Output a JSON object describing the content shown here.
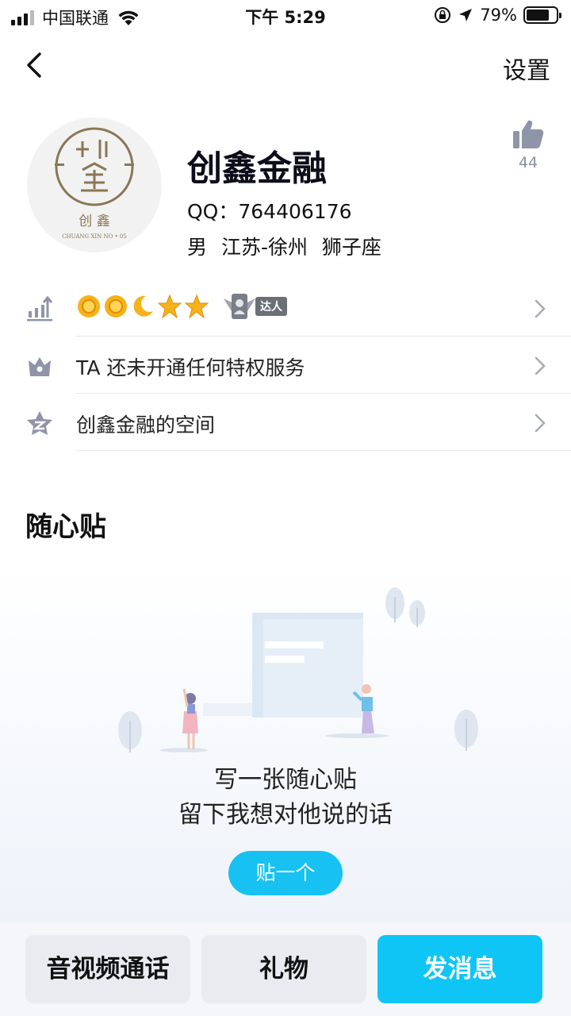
{
  "status_bar": {
    "carrier": "中国联通",
    "time": "下午 5:29",
    "battery": "79%",
    "battery_level": 0.79
  },
  "nav": {
    "settings_label": "设置"
  },
  "profile": {
    "name": "创鑫金融",
    "qq": "QQ：764406176",
    "info": "男 江苏-徐州 狮子座",
    "likes": "44",
    "avatar_logo_text": "创 鑫",
    "avatar_logo_sub": "CHUANG XIN NO • 05"
  },
  "list": {
    "level_row": {
      "level_icons": [
        "sun",
        "sun",
        "moon",
        "star",
        "star"
      ],
      "talent_label": "达人"
    },
    "privilege_row": {
      "label": "TA 还未开通任何特权服务"
    },
    "space_row": {
      "label": "创鑫金融的空间"
    }
  },
  "sticky": {
    "title": "随心贴",
    "line1": "写一张随心贴",
    "line2": "留下我想对他说的话",
    "button": "贴一个"
  },
  "bottom_bar": {
    "call": "音视频通话",
    "gift": "礼物",
    "message": "发消息"
  },
  "colors": {
    "accent": "#0fc5f6",
    "icon_gray": "#8f94a8"
  }
}
